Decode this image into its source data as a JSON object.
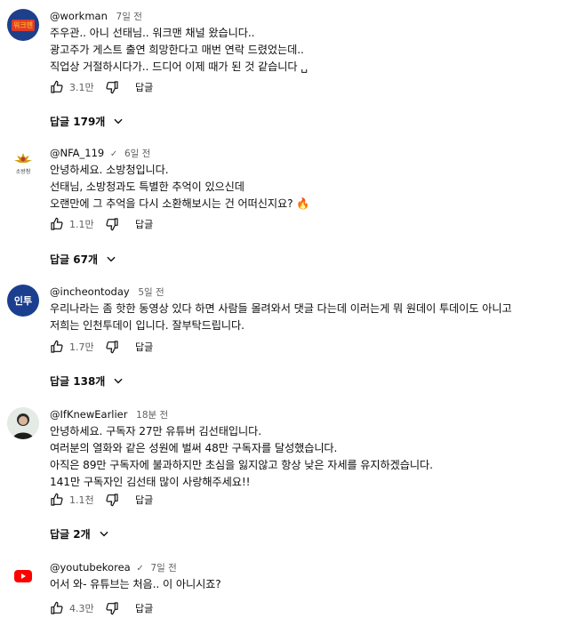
{
  "comments": [
    {
      "handle": "@workman",
      "verified": false,
      "time": "7일 전",
      "lines": [
        "주우관.. 아니 선태님.. 워크맨 채널 왔습니다..",
        "광고주가 게스트 출연 희망한다고 매번 연락 드렸었는데..",
        "직업상 거절하시다가.. 드디어 이제 때가 된 것 같습니다 ␣"
      ],
      "likes": "3.1만",
      "reply_label": "답글",
      "replies_label": "답글 179개",
      "avatar_text": "워크맨",
      "avatar_bg": "#1e3f8a",
      "avatar_fg": "#f5a623"
    },
    {
      "handle": "@NFA_119",
      "verified": true,
      "time": "6일 전",
      "lines": [
        "안녕하세요. 소방청입니다.",
        "선태님, 소방청과도 특별한 추억이 있으신데",
        "오랜만에 그 추억을 다시 소환해보시는 건 어떠신지요? 🔥"
      ],
      "likes": "1.1만",
      "reply_label": "답글",
      "replies_label": "답글 67개",
      "avatar_text": "소방청",
      "avatar_bg": "#ffffff",
      "avatar_fg": "#333333"
    },
    {
      "handle": "@incheontoday",
      "verified": false,
      "time": "5일 전",
      "lines": [
        "우리나라는 좀 핫한 동영상 있다 하면 사람들 몰려와서 댓글 다는데 이러는게 뭐 원데이 투데이도 아니고",
        "저희는 인천투데이 입니다. 잘부탁드립니다."
      ],
      "likes": "1.7만",
      "reply_label": "답글",
      "replies_label": "답글 138개",
      "avatar_text": "인투",
      "avatar_bg": "#1b3f8f",
      "avatar_fg": "#ffffff"
    },
    {
      "handle": "@IfKnewEarlier",
      "verified": false,
      "time": "18분 전",
      "lines": [
        "안녕하세요. 구독자 27만 유튜버 김선태입니다.",
        "여러분의 열화와 같은 성원에 벌써 48만 구독자를 달성했습니다.",
        "아직은 89만 구독자에 불과하지만 초심을 잃지않고 항상 낮은 자세를 유지하겠습니다.",
        "141만 구독자인 김선태 많이 사랑해주세요!!"
      ],
      "likes": "1.1천",
      "reply_label": "답글",
      "replies_label": "답글 2개",
      "avatar_text": "",
      "avatar_bg": "#dfe7df",
      "avatar_fg": "#222222"
    },
    {
      "handle": "@youtubekorea",
      "verified": true,
      "time": "7일 전",
      "lines": [
        "어서 와- 유튜브는 처음.. 이 아니시죠?"
      ],
      "likes": "4.3만",
      "reply_label": "답글",
      "replies_label": "",
      "avatar_text": "",
      "avatar_bg": "#ffffff",
      "avatar_fg": "#ff0000"
    }
  ],
  "colors": {
    "muted": "#606060",
    "text": "#0f0f0f",
    "brand_red": "#ff0000"
  }
}
